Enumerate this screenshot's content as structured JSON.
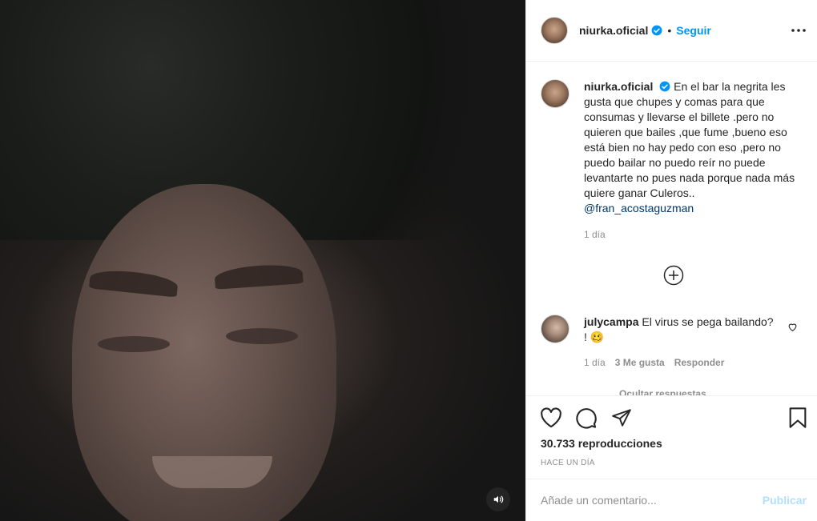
{
  "post": {
    "username": "niurka.oficial",
    "dot": "•",
    "follow_label": "Seguir",
    "caption_username": "niurka.oficial",
    "caption_text": "En el bar la negrita les gusta que chupes y comas para que consumas y llevarse el billete .pero no quieren que bailes ,que fume ,bueno eso está bien no hay pedo con eso ,pero no puedo bailar no puedo reír no puede levantarte no pues nada porque nada más quiere ganar Culeros..",
    "caption_mention": "@fran_acostaguzman",
    "caption_time": "1 día"
  },
  "comment": {
    "username": "julycampa",
    "text": "El virus se pega bailando? ! 🥴",
    "time": "1 día",
    "likes": "3 Me gusta",
    "reply_label": "Responder",
    "hide_replies": "Ocultar respuestas"
  },
  "stats": {
    "views_number": "30.733",
    "views_label": "reproducciones",
    "time_ago": "HACE UN DÍA"
  },
  "composer": {
    "placeholder": "Añade un comentario...",
    "publish_label": "Publicar"
  },
  "colors": {
    "accent": "#0095f6",
    "publish_disabled": "#b2dffc",
    "muted": "#8e8e8e",
    "mention": "#00376b"
  },
  "icons": [
    "volume-icon",
    "verified-badge-icon",
    "more-options-icon",
    "load-more-comments-icon",
    "heart-icon",
    "comment-icon",
    "share-icon",
    "bookmark-icon"
  ]
}
